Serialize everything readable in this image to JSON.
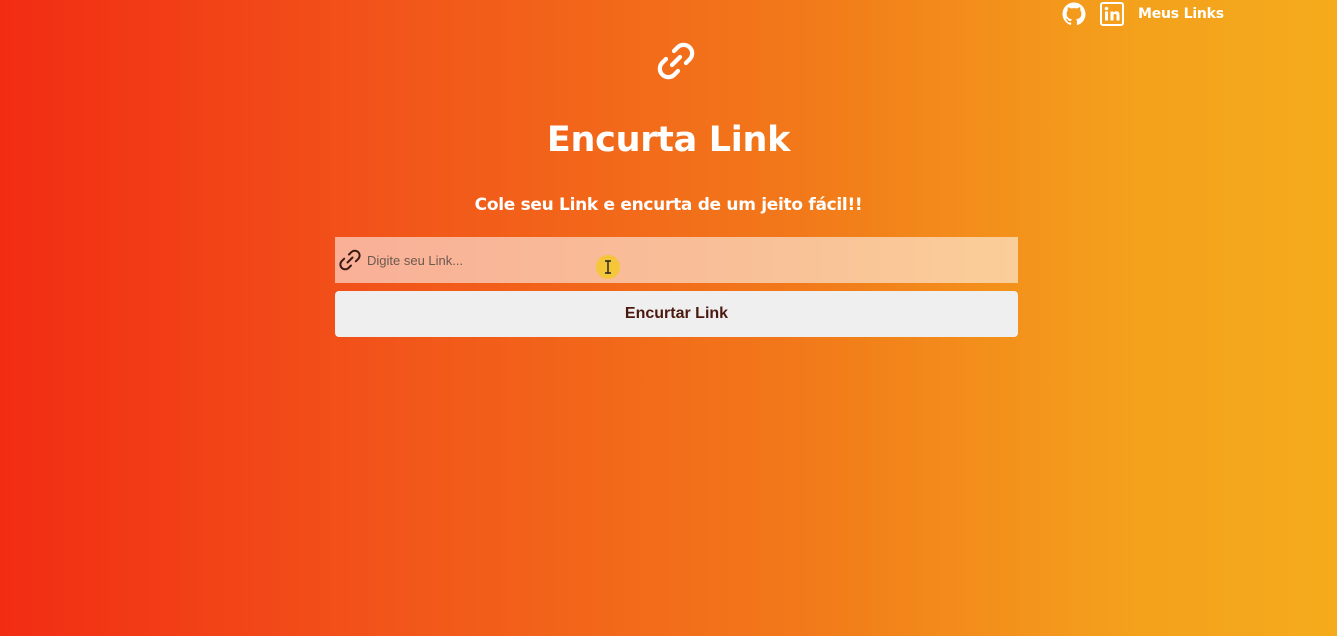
{
  "nav": {
    "github_icon": "github-icon",
    "linkedin_icon": "linkedin-icon",
    "my_links_label": "Meus Links"
  },
  "header": {
    "logo_icon": "link-icon",
    "title": "Encurta Link",
    "subtitle": "Cole seu Link e encurta de um jeito fácil!!"
  },
  "form": {
    "input_icon": "link-icon",
    "input_value": "",
    "input_placeholder": "Digite seu Link...",
    "submit_label": "Encurtar Link"
  },
  "colors": {
    "gradient_start": "#f22c13",
    "gradient_end": "#f5ab1c",
    "button_text": "#4a1a10",
    "button_bg": "#efefef"
  }
}
